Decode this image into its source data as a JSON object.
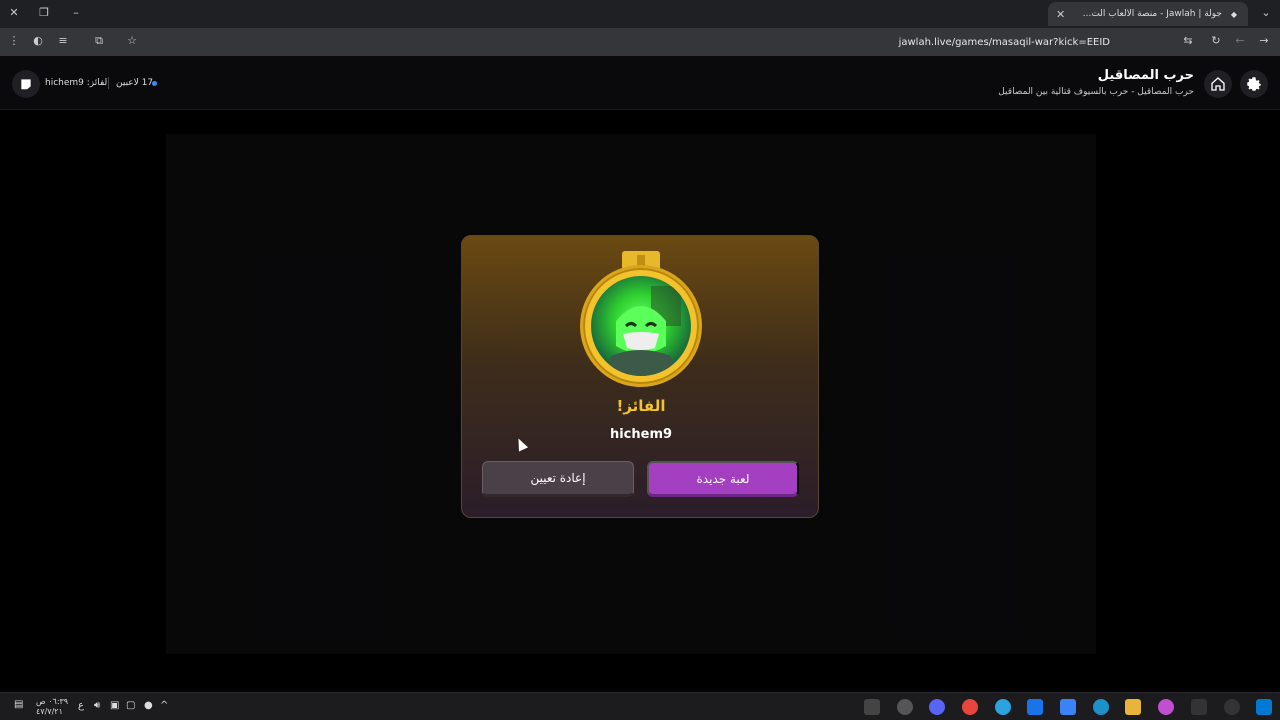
{
  "browser": {
    "tab_title": "جولة | Jawlah - منصة الألعاب الت...",
    "url": "jawlah.live/games/masaqil-war?kick=EEID"
  },
  "header": {
    "game_title": "حرب المصاقيل",
    "game_subtitle": "حرب المصاقيل - حرب بالسيوف قتالية بين المصاقيل",
    "winner_label": "الفائز: hichem9",
    "players_count": "17 لاعبين"
  },
  "modal": {
    "title": "الفائز!",
    "winner_name": "hichem9",
    "new_game_label": "لعبة جديدة",
    "reset_label": "إعادة تعيين"
  },
  "taskbar": {
    "time": "٠٦:٣٩ ص",
    "date": "٤٧/٧/٢١",
    "lang": "ع"
  },
  "colors": {
    "accent_purple": "#a43fc2",
    "gold": "#f2c230"
  }
}
